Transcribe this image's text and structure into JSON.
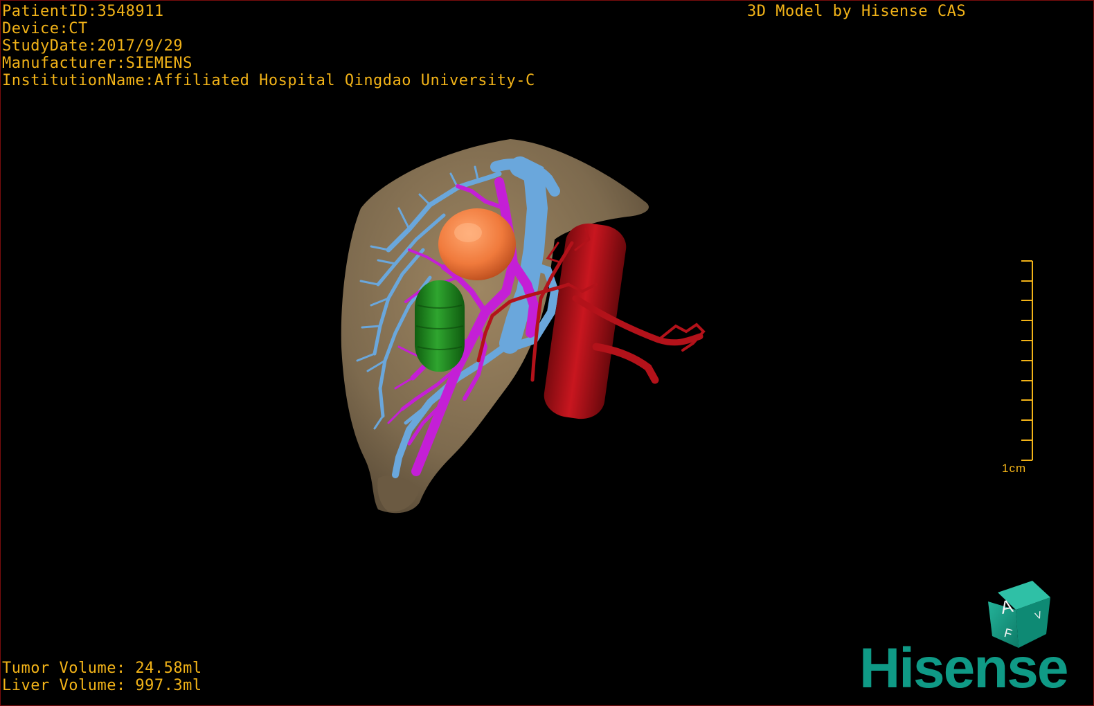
{
  "patient_info": {
    "patient_id": "PatientID:3548911",
    "device": "Device:CT",
    "study_date": "StudyDate:2017/9/29",
    "manufacturer": "Manufacturer:SIEMENS",
    "institution": "InstitutionName:Affiliated Hospital Qingdao University-C"
  },
  "model_credit": "3D Model by Hisense CAS",
  "volumes": {
    "tumor": "Tumor Volume: 24.58ml",
    "liver": "Liver Volume: 997.3ml"
  },
  "scale_bar": {
    "label": "1cm"
  },
  "orientation_cube": {
    "face_front": "A",
    "face_side": "V",
    "face_bottom": "F"
  },
  "brand": {
    "logo": "Hisense"
  },
  "colors": {
    "overlay_text": "#f2b318",
    "liver": "#8a7456",
    "portal_vein": "#6aa7dc",
    "hepatic_vein": "#c41fd6",
    "tumor": "#f07a3c",
    "gallbladder": "#1f8a1f",
    "artery": "#b3121a",
    "brand": "#0f9a86",
    "viewport_border": "#7a0d0d"
  },
  "icons": [
    "orientation-cube-icon",
    "scale-bar-icon",
    "hisense-logo"
  ]
}
